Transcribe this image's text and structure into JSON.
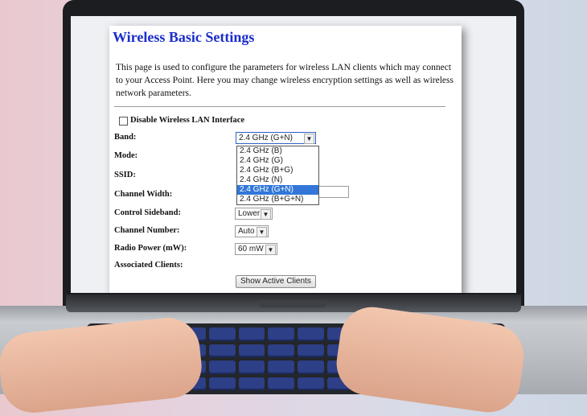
{
  "page": {
    "title": "Wireless Basic Settings",
    "description": "This page is used to configure the parameters for wireless LAN clients which may connect to your Access Point. Here you may change wireless encryption settings as well as wireless network parameters."
  },
  "form": {
    "disable_label": "Disable Wireless LAN Interface",
    "band_label": "Band:",
    "band_value": "2.4 GHz (G+N)",
    "band_options": [
      "2.4 GHz (B)",
      "2.4 GHz (G)",
      "2.4 GHz (B+G)",
      "2.4 GHz (N)",
      "2.4 GHz (G+N)",
      "2.4 GHz (B+G+N)"
    ],
    "mode_label": "Mode:",
    "ssid_label": "SSID:",
    "channel_width_label": "Channel Width:",
    "control_sideband_label": "Control Sideband:",
    "control_sideband_value": "Lower",
    "channel_number_label": "Channel Number:",
    "channel_number_value": "Auto",
    "radio_power_label": "Radio Power (mW):",
    "radio_power_value": "60 mW",
    "associated_clients_label": "Associated Clients:",
    "show_clients_button": "Show Active Clients"
  }
}
